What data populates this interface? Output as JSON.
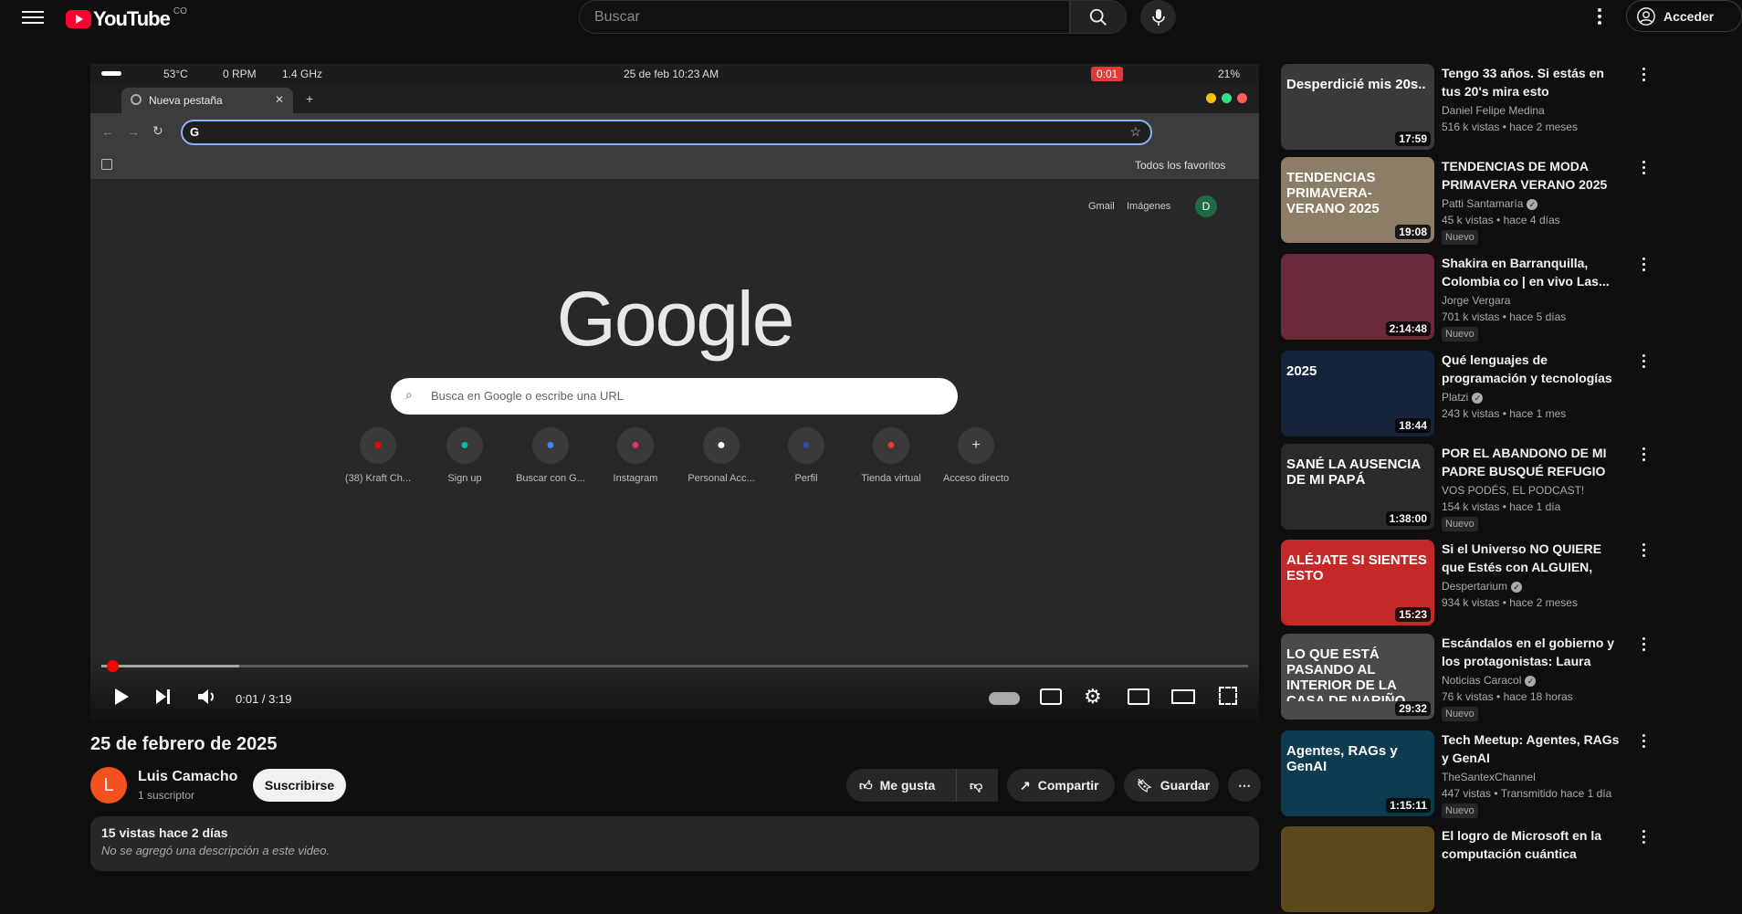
{
  "masthead": {
    "logo_text": "YouTube",
    "country_code": "CO",
    "search_placeholder": "Buscar",
    "signin_label": "Acceder"
  },
  "player": {
    "osbar": {
      "temp": "53°C",
      "rpm": "0 RPM",
      "freq": "1.4 GHz",
      "datetime": "25 de feb  10:23 AM",
      "rec_time": "0:01",
      "battery": "21%"
    },
    "browser": {
      "tab_title": "Nueva pestaña",
      "bookmarks_label": "Todos los favoritos",
      "gmail": "Gmail",
      "images": "Imágenes",
      "account_initial": "D",
      "logo": "Google",
      "search_placeholder": "Busca en Google o escribe una URL",
      "shortcuts": [
        {
          "label": "(38) Kraft Ch...",
          "icon": "youtube-icon",
          "color": "#ff0000"
        },
        {
          "label": "Sign up",
          "icon": "diamond-icon",
          "color": "#00bfa5"
        },
        {
          "label": "Buscar con G...",
          "icon": "google-icon",
          "color": "#4285f4"
        },
        {
          "label": "Instagram",
          "icon": "instagram-icon",
          "color": "#e1306c"
        },
        {
          "label": "Personal Acc...",
          "icon": "github-icon",
          "color": "#ffffff"
        },
        {
          "label": "Perfil",
          "icon": "profile-icon",
          "color": "#3949ab"
        },
        {
          "label": "Tienda virtual",
          "icon": "store-icon",
          "color": "#e53935"
        },
        {
          "label": "Acceso directo",
          "icon": "plus-icon",
          "color": "#dddddd"
        }
      ]
    },
    "time_display": "0:01 / 3:19",
    "progress_fraction": 0.005
  },
  "video": {
    "title": "25 de febrero de 2025",
    "channel": "Luis Camacho",
    "channel_initial": "L",
    "subscribers": "1 suscriptor",
    "subscribe_label": "Suscribirse",
    "like_label": "Me gusta",
    "share_label": "Compartir",
    "save_label": "Guardar",
    "views_line": "15 vistas  hace 2 días",
    "description": "No se agregó una descripción a este video."
  },
  "recommendations": [
    {
      "title": "Tengo 33 años. Si estás en tus 20's mira esto",
      "channel": "Daniel Felipe Medina",
      "verified": false,
      "views": "516 k vistas",
      "age": "hace 2 meses",
      "duration": "17:59",
      "badge": "",
      "thumb_text": "Desperdicié mis 20s..",
      "thumb_color": "#3b3b3b"
    },
    {
      "title": "TENDENCIAS DE MODA PRIMAVERA VERANO 2025 -...",
      "channel": "Patti Santamaría",
      "verified": true,
      "views": "45 k vistas",
      "age": "hace 4 días",
      "duration": "19:08",
      "badge": "Nuevo",
      "thumb_text": "TENDENCIAS PRIMAVERA-VERANO 2025",
      "thumb_color": "#8c7d66"
    },
    {
      "title": "Shakira en Barranquilla, Colombia co | en vivo Las...",
      "channel": "Jorge Vergara",
      "verified": false,
      "views": "701 k vistas",
      "age": "hace 5 días",
      "duration": "2:14:48",
      "badge": "Nuevo",
      "thumb_text": "",
      "thumb_color": "#6b2a3a"
    },
    {
      "title": "Qué lenguajes de programación y tecnologías aprender en el...",
      "channel": "Platzi",
      "verified": true,
      "views": "243 k vistas",
      "age": "hace 1 mes",
      "duration": "18:44",
      "badge": "",
      "thumb_text": "2025",
      "thumb_color": "#16243b"
    },
    {
      "title": "POR EL ABANDONO DE MI PADRE BUSQUÉ REFUGIO EN...",
      "channel": "VOS PODÉS, EL PODCAST!",
      "verified": false,
      "views": "154 k vistas",
      "age": "hace 1 día",
      "duration": "1:38:00",
      "badge": "Nuevo",
      "thumb_text": "SANÉ LA AUSENCIA DE MI PAPÁ",
      "thumb_color": "#2a2a2a"
    },
    {
      "title": "Si el Universo NO QUIERE que Estés con ALGUIEN, Estas...",
      "channel": "Despertarium",
      "verified": true,
      "views": "934 k vistas",
      "age": "hace 2 meses",
      "duration": "15:23",
      "badge": "",
      "thumb_text": "ALÉJATE SI SIENTES ESTO",
      "thumb_color": "#c62828"
    },
    {
      "title": "Escándalos en el gobierno y los protagonistas: Laura Sarabia,...",
      "channel": "Noticias Caracol",
      "verified": true,
      "views": "76 k vistas",
      "age": "hace 18 horas",
      "duration": "29:32",
      "badge": "Nuevo",
      "thumb_text": "LO QUE ESTÁ PASANDO AL INTERIOR DE LA CASA DE NARIÑO",
      "thumb_color": "#4a4a4a"
    },
    {
      "title": "Tech Meetup: Agentes, RAGs y GenAI",
      "channel": "TheSantexChannel",
      "verified": false,
      "views": "447 vistas",
      "age": "Transmitido hace 1 día",
      "duration": "1:15:11",
      "badge": "Nuevo",
      "thumb_text": "Agentes, RAGs y GenAI",
      "thumb_color": "#0d3b4f"
    },
    {
      "title": "El logro de Microsoft en la computación cuántica",
      "channel": "",
      "verified": false,
      "views": "",
      "age": "",
      "duration": "",
      "badge": "",
      "thumb_text": "",
      "thumb_color": "#5d4a1a"
    }
  ]
}
